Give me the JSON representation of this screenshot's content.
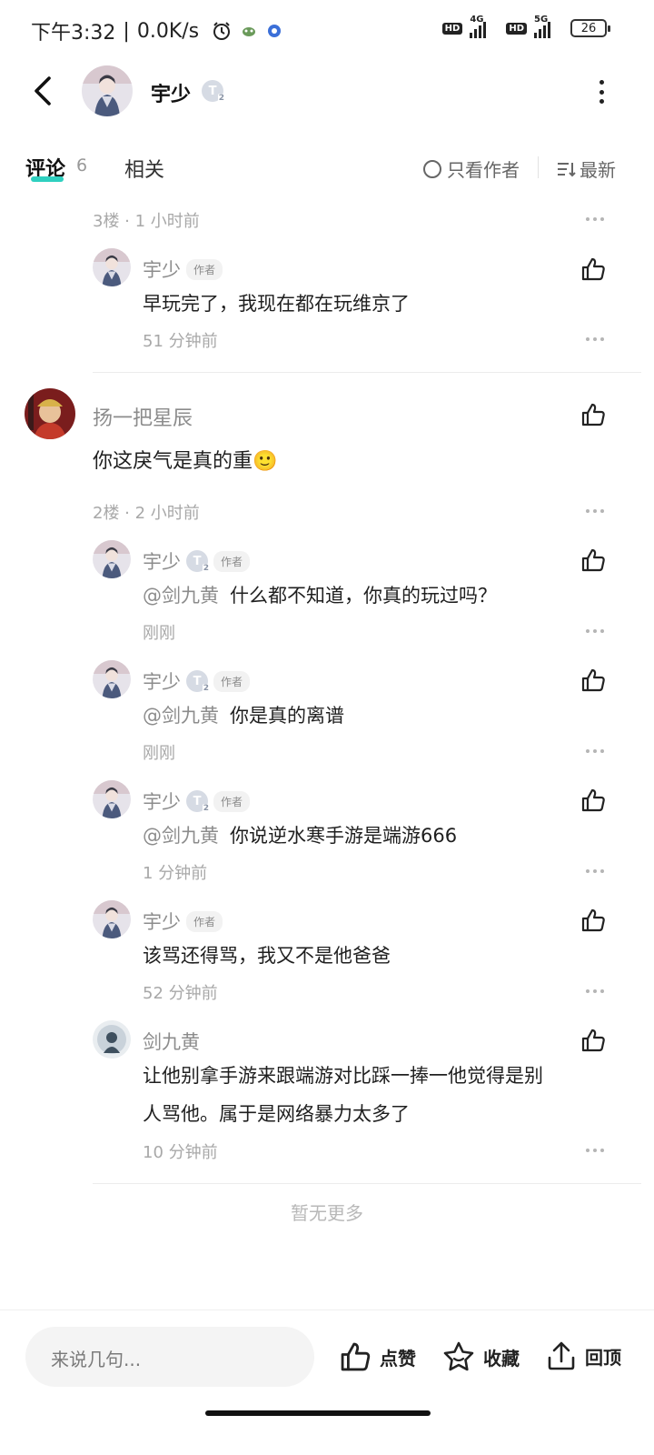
{
  "status_bar": {
    "time": "下午3:32",
    "speed": "0.0K/s",
    "hd": "HD",
    "net1": "4G",
    "net2": "5G",
    "battery": "26"
  },
  "header": {
    "title": "宇少",
    "level": "T",
    "level_sub": "2"
  },
  "tabs": {
    "comments_label": "评论",
    "comments_count": "6",
    "related_label": "相关",
    "author_only_label": "只看作者",
    "sort_label": "最新"
  },
  "threads": [
    {
      "floor_meta": "3楼 · 1 小时前",
      "replies": [
        {
          "name": "宇少",
          "author_tag": "作者",
          "text": "早玩完了，我现在都在玩维京了",
          "time": "51 分钟前"
        }
      ]
    },
    {
      "name": "扬一把星辰",
      "text": "你这戾气是真的重🙂",
      "floor_meta": "2楼 · 2 小时前",
      "replies": [
        {
          "name": "宇少",
          "level": "T",
          "level_sub": "2",
          "author_tag": "作者",
          "mention": "@剑九黄",
          "text": "什么都不知道，你真的玩过吗？",
          "time": "刚刚"
        },
        {
          "name": "宇少",
          "level": "T",
          "level_sub": "2",
          "author_tag": "作者",
          "mention": "@剑九黄",
          "text": "你是真的离谱",
          "time": "刚刚"
        },
        {
          "name": "宇少",
          "level": "T",
          "level_sub": "2",
          "author_tag": "作者",
          "mention": "@剑九黄",
          "text": "你说逆水寒手游是端游666",
          "time": "1 分钟前"
        },
        {
          "name": "宇少",
          "author_tag": "作者",
          "text": "该骂还得骂，我又不是他爸爸",
          "time": "52 分钟前"
        },
        {
          "name": "剑九黄",
          "text_line1": "让他别拿手游来跟端游对比踩一捧一他觉得是别",
          "text_line2": "人骂他。属于是网络暴力太多了",
          "time": "10 分钟前"
        }
      ]
    }
  ],
  "no_more": "暂无更多",
  "bottom": {
    "input_placeholder": "来说几句...",
    "like_label": "点赞",
    "favorite_label": "收藏",
    "top_label": "回顶"
  }
}
